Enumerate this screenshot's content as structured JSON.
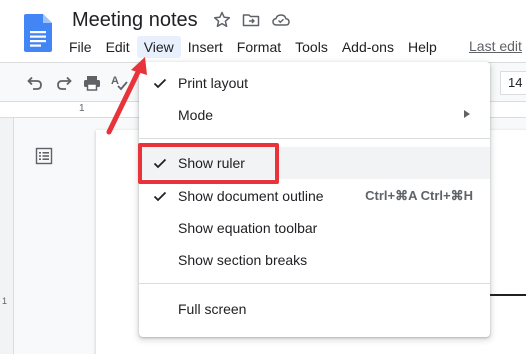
{
  "header": {
    "title": "Meeting notes",
    "last_edit": "Last edit"
  },
  "menubar": {
    "items": [
      {
        "label": "File"
      },
      {
        "label": "Edit"
      },
      {
        "label": "View"
      },
      {
        "label": "Insert"
      },
      {
        "label": "Format"
      },
      {
        "label": "Tools"
      },
      {
        "label": "Add-ons"
      },
      {
        "label": "Help"
      }
    ],
    "active": "View"
  },
  "toolbar": {
    "font_size": "14"
  },
  "ruler": {
    "top_number": "1",
    "side_number": "1"
  },
  "view_menu": {
    "items": [
      {
        "label": "Print layout",
        "checked": true
      },
      {
        "label": "Mode",
        "submenu": true
      },
      {
        "label": "Show ruler",
        "checked": true,
        "highlighted": true
      },
      {
        "label": "Show document outline",
        "checked": true,
        "shortcut": "Ctrl+⌘A Ctrl+⌘H"
      },
      {
        "label": "Show equation toolbar"
      },
      {
        "label": "Show section breaks"
      },
      {
        "label": "Full screen"
      }
    ]
  },
  "annotation": {
    "color": "#e8333a"
  },
  "colors": {
    "docs_blue": "#4285f4",
    "menu_active_bg": "#e8f0fe",
    "highlight_bg": "#f1f3f4"
  }
}
